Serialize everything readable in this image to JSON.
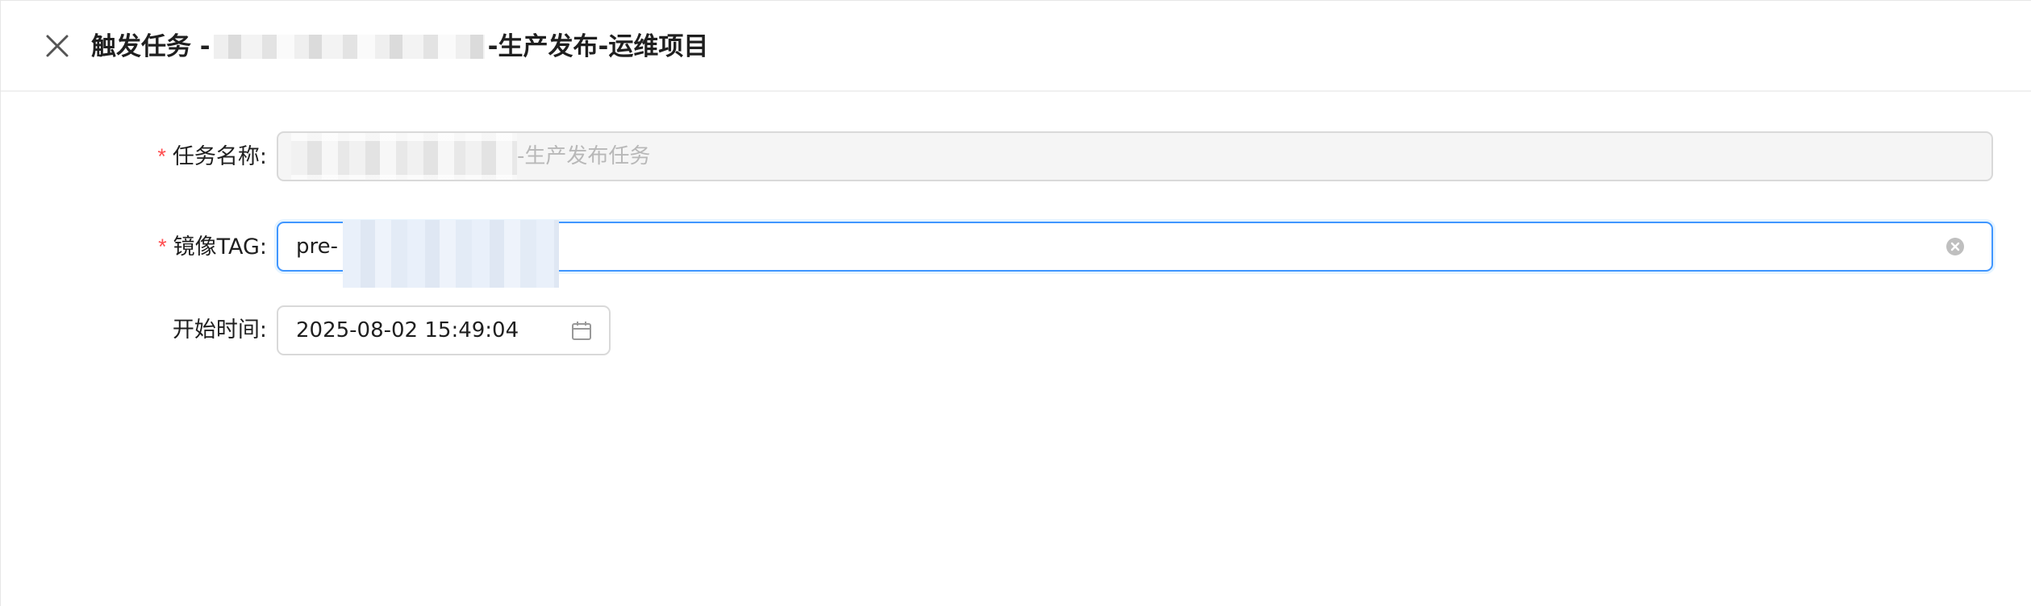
{
  "header": {
    "close_icon": "close-icon",
    "title_prefix": "触发任务 -",
    "title_suffix": "-生产发布-运维项目"
  },
  "form": {
    "task_name": {
      "label": "任务名称:",
      "required_mark": "*",
      "value_suffix": "-生产发布任务",
      "disabled": true
    },
    "image_tag": {
      "label": "镜像TAG:",
      "required_mark": "*",
      "value_prefix": "pre-",
      "clear_icon": "clear-circle-icon",
      "focused": true
    },
    "start_time": {
      "label": "开始时间:",
      "value": "2025-08-02 15:49:04",
      "calendar_icon": "calendar-icon"
    }
  },
  "colors": {
    "required": "#ff4d4f",
    "focus_border": "#4096ff",
    "disabled_bg": "#f5f5f5"
  }
}
